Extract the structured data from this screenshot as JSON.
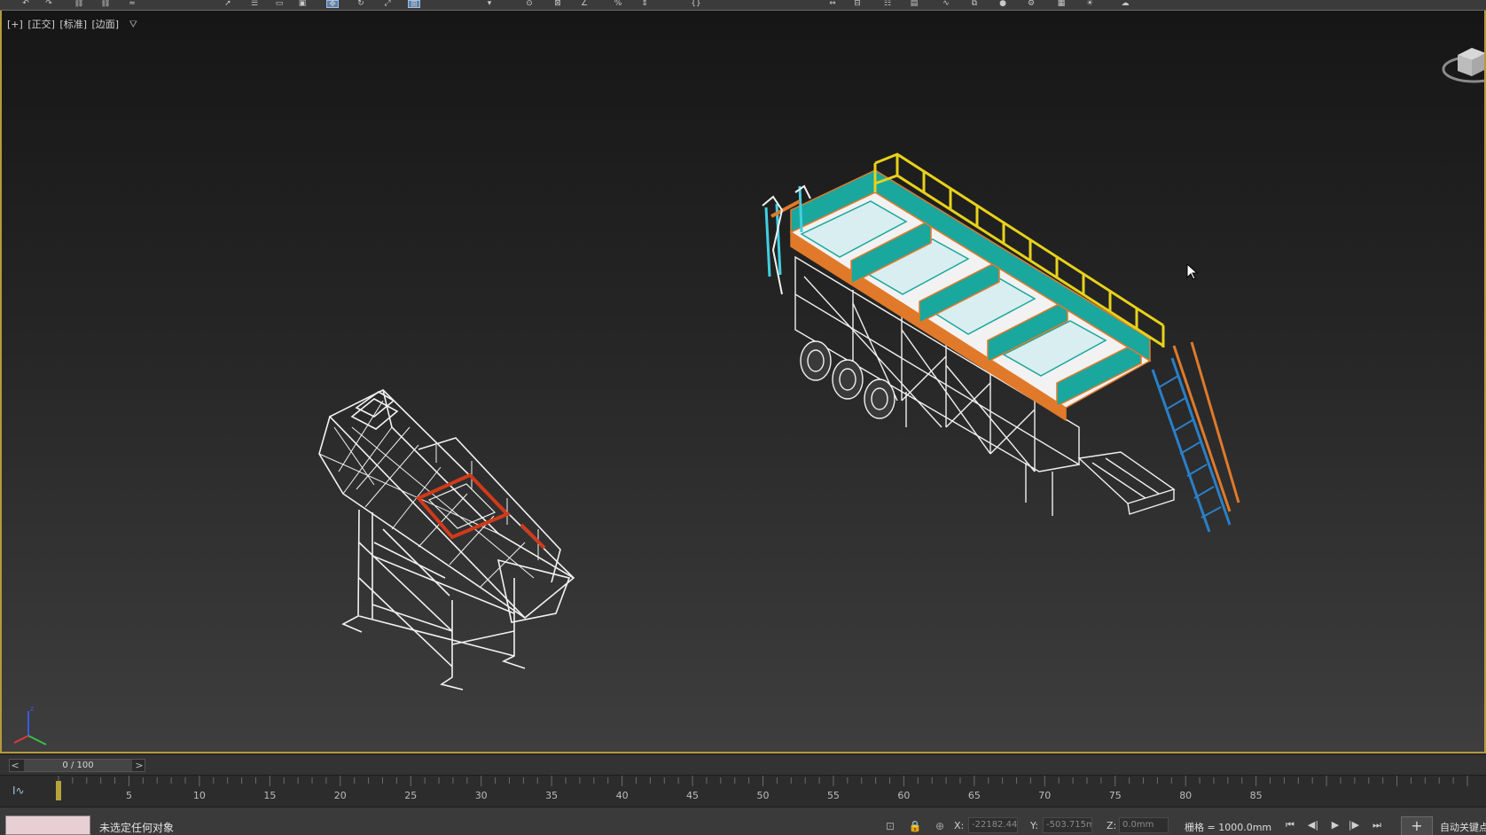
{
  "toolbar": {
    "icons": [
      "undo-icon",
      "redo-icon",
      "link-icon",
      "unlink-icon",
      "bind-space-warp-icon",
      "select-icon",
      "select-by-name-icon",
      "rect-selection-icon",
      "window-crossing-icon",
      "move-icon",
      "rotate-icon",
      "scale-icon",
      "placement-icon",
      "reference-coord-icon",
      "pivot-icon",
      "snap-toggle-icon",
      "angle-snap-icon",
      "percent-snap-icon",
      "spinner-snap-icon",
      "named-selection-icon",
      "mirror-icon",
      "align-icon",
      "layer-explorer-icon",
      "ribbon-icon",
      "curve-editor-icon",
      "schematic-icon",
      "material-editor-icon",
      "render-setup-icon",
      "render-frame-icon",
      "render-icon",
      "a360-icon"
    ]
  },
  "viewport": {
    "label_parts": [
      "[+]",
      "[正交]",
      "[标准]",
      "[边面]"
    ],
    "filter_icon": "funnel-icon"
  },
  "timeline": {
    "slider_text": "0 / 100",
    "prev_label": "<",
    "next_label": ">",
    "ticks": [
      "5",
      "10",
      "15",
      "20",
      "25",
      "30",
      "35",
      "40",
      "45",
      "50",
      "55",
      "60",
      "65",
      "70",
      "75",
      "80",
      "85"
    ],
    "current_frame": 0,
    "total_frames": 100,
    "curve_icon": "I∿"
  },
  "status": {
    "message": "未选定任何对象",
    "x_label": "X:",
    "x_value": "-22182.44",
    "y_label": "Y:",
    "y_value": "-503.715m",
    "z_label": "Z:",
    "z_value": "0.0mm",
    "grid_text": "栅格 = 1000.0mm",
    "autokey_label": "自动关键点"
  },
  "colors": {
    "accent_border": "#b59a3d",
    "orange": "#e07a2a",
    "yellow": "#e8d21a",
    "teal": "#1aa79e",
    "blue": "#2a7fc8",
    "red": "#d03a1a"
  }
}
